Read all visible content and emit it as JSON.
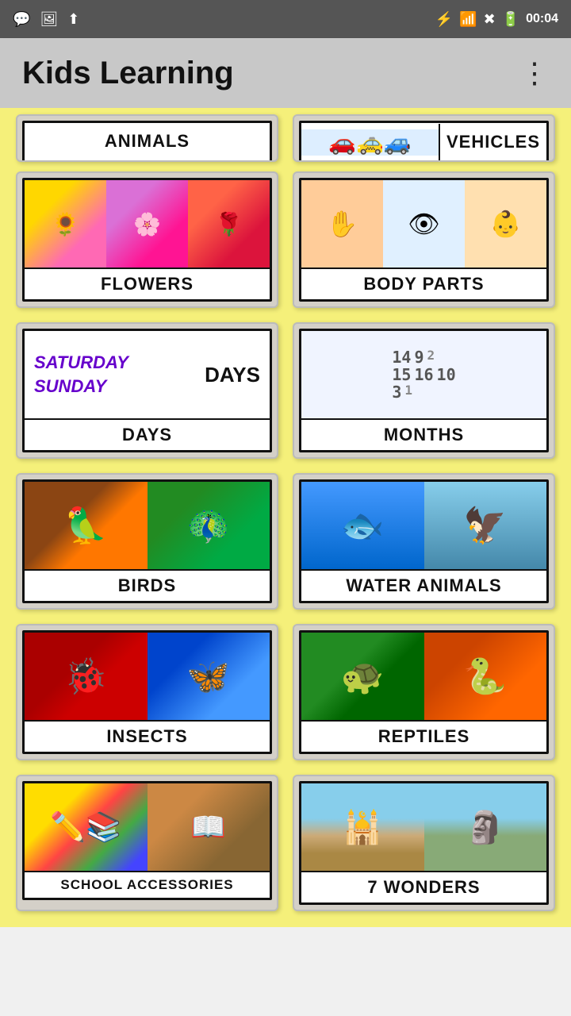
{
  "statusBar": {
    "time": "00:04",
    "icons": [
      "whatsapp",
      "image",
      "upload",
      "bluetooth",
      "signal",
      "network-off",
      "battery"
    ]
  },
  "appBar": {
    "title": "Kids Learning",
    "moreLabel": "⋮"
  },
  "categories": [
    {
      "id": "animals",
      "label": "ANIMALS",
      "imgType": "animals"
    },
    {
      "id": "vehicles",
      "label": "VEHICLES",
      "imgType": "vehicles"
    },
    {
      "id": "flowers",
      "label": "FLOWERS",
      "imgType": "flowers"
    },
    {
      "id": "body-parts",
      "label": "BODY PARTS",
      "imgType": "body"
    },
    {
      "id": "days",
      "label": "DAYS",
      "imgType": "days"
    },
    {
      "id": "months",
      "label": "MONTHS",
      "imgType": "months"
    },
    {
      "id": "birds",
      "label": "BIRDS",
      "imgType": "birds"
    },
    {
      "id": "water-animals",
      "label": "WATER ANIMALS",
      "imgType": "water"
    },
    {
      "id": "insects",
      "label": "INSECTS",
      "imgType": "insects"
    },
    {
      "id": "reptiles",
      "label": "REPTILES",
      "imgType": "reptiles"
    },
    {
      "id": "school-accessories",
      "label": "SCHOOL ACCESSORIES",
      "imgType": "school"
    },
    {
      "id": "7-wonders",
      "label": "7 WONDERS",
      "imgType": "wonders"
    }
  ]
}
